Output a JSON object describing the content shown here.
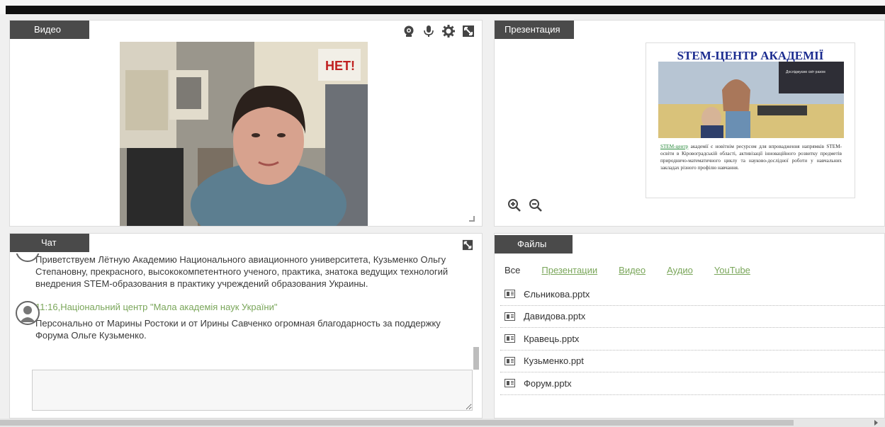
{
  "video": {
    "title": "Видео",
    "icons": [
      "webcam-icon",
      "microphone-icon",
      "gear-icon",
      "expand-icon"
    ],
    "cam_sign": "НЕТ!"
  },
  "presentation": {
    "title": "Презентация",
    "slide_title": "STEM-ЦЕНТР АКАДЕМІЇ",
    "slide_caption_box": "Досліджуємо світ разом",
    "slide_link": "STEM-центр",
    "slide_text": " академії є новітнім ресурсом для впровадження напрямків STEM-освіти в Кіровоградській області, активізації інноваційного розвитку предметів природничо-математичного циклу та науково-дослідної роботи у навчальних закладах різного профілю навчання.",
    "zoom_icons": [
      "zoom-in-icon",
      "zoom-out-icon"
    ]
  },
  "chat": {
    "title": "Чат",
    "messages": [
      {
        "author": "",
        "time": "",
        "text": "Приветствуем Лётную Академию Национального авиационного университета, Кузьменко Ольгу Степановну, прекрасного, высококомпетентного ученого, практика, знатока ведущих технологий внедрения STEM-образования в практику учреждений образования Украины."
      },
      {
        "author": "Національний центр \"Мала академія наук України\"",
        "time": "11:16,",
        "text": "Персонально от Марины Ростоки и от Ирины Савченко огромная благодарность за поддержку Форума Ольге Кузьменко."
      }
    ],
    "input_placeholder": ""
  },
  "files": {
    "title": "Файлы",
    "tabs": [
      {
        "label": "Все",
        "active": true
      },
      {
        "label": "Презентации",
        "active": false
      },
      {
        "label": "Видео",
        "active": false
      },
      {
        "label": "Аудио",
        "active": false
      },
      {
        "label": "YouTube",
        "active": false
      }
    ],
    "items": [
      {
        "name": "Єльникова.pptx"
      },
      {
        "name": "Давидова.pptx"
      },
      {
        "name": "Кравець.pptx"
      },
      {
        "name": "Кузьменко.ppt"
      },
      {
        "name": "Форум.pptx"
      }
    ]
  },
  "colors": {
    "header_bg": "#4a4a4a",
    "link_green": "#7aa65a",
    "slide_title_blue": "#1a2b8f"
  }
}
